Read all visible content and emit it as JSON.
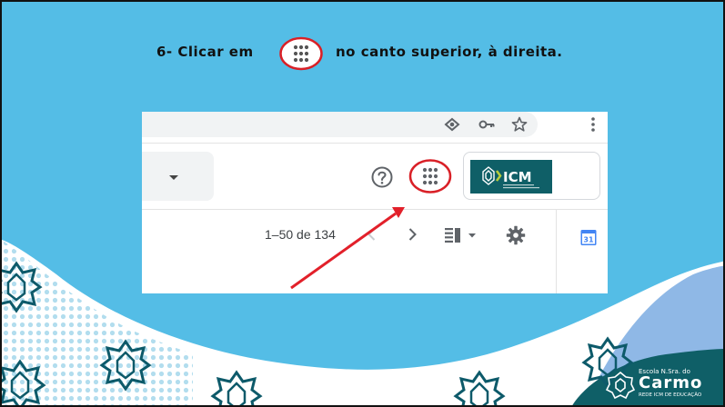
{
  "instruction": {
    "before_text": "6- Clicar em",
    "after_text": "no canto superior, à direita.",
    "icon": "apps-grid-icon"
  },
  "browser_toolbar": {
    "icons": [
      "eye-icon",
      "key-icon",
      "star-icon",
      "kebab-menu-icon"
    ]
  },
  "gmail_header": {
    "search_dropdown_icon": "caret-down-icon",
    "help_icon": "help-circle-icon",
    "apps_icon": "google-apps-grid-icon",
    "account_logo_text": "ICM"
  },
  "gmail_toolbar": {
    "pager_text": "1–50 de 134",
    "prev_icon": "chevron-left-icon",
    "next_icon": "chevron-right-icon",
    "split_pane_icon": "split-pane-icon",
    "settings_icon": "gear-icon",
    "calendar_badge": "31"
  },
  "school": {
    "line1": "Escola N.Sra. do",
    "line2": "Carmo",
    "line3": "REDE ICM DE EDUCAÇÃO"
  },
  "colors": {
    "background": "#54bde6",
    "bottom_blue": "#8fb8e6",
    "teal": "#0f5f67",
    "highlight_red": "#e2202a"
  }
}
